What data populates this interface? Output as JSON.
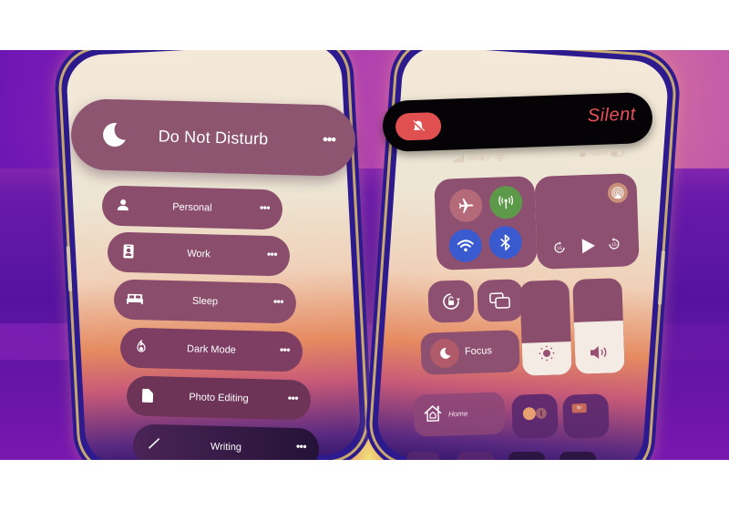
{
  "scene": {
    "description": "Two iPhones showing iOS Focus modes and Control Center"
  },
  "left_phone": {
    "dnd": {
      "label": "Do Not Disturb",
      "icon": "moon-icon",
      "more": "•••"
    },
    "focus_modes": [
      {
        "label": "Personal",
        "icon": "person-icon",
        "more": "•••"
      },
      {
        "label": "Work",
        "icon": "id-badge-icon",
        "more": "•••"
      },
      {
        "label": "Sleep",
        "icon": "bed-icon",
        "more": "•••"
      },
      {
        "label": "Dark Mode",
        "icon": "flame-icon",
        "more": "•••"
      },
      {
        "label": "Photo Editing",
        "icon": "document-icon",
        "more": "•••"
      },
      {
        "label": "Writing",
        "icon": "pencil-icon",
        "more": "•••"
      }
    ]
  },
  "right_phone": {
    "silent_banner": {
      "label": "Silent",
      "icon": "bell-slash-icon",
      "accent": "#e05050"
    },
    "status_bar": {
      "carrier": "AT&T",
      "battery": "48%"
    },
    "control_center": {
      "connectivity": [
        {
          "name": "airplane-mode",
          "icon": "airplane-icon",
          "color": "#b46a78"
        },
        {
          "name": "cellular-data",
          "icon": "antenna-icon",
          "color": "#5c9a4a"
        },
        {
          "name": "wifi",
          "icon": "wifi-icon",
          "color": "#3a5ad0"
        },
        {
          "name": "bluetooth",
          "icon": "bluetooth-icon",
          "color": "#3a5ad0"
        }
      ],
      "media": {
        "skip_back": "15",
        "skip_forward": "15"
      },
      "focus_label": "Focus",
      "brightness_level": 0.35,
      "volume_level": 0.55,
      "home_label": "Home",
      "appletv_label": "tv"
    }
  }
}
